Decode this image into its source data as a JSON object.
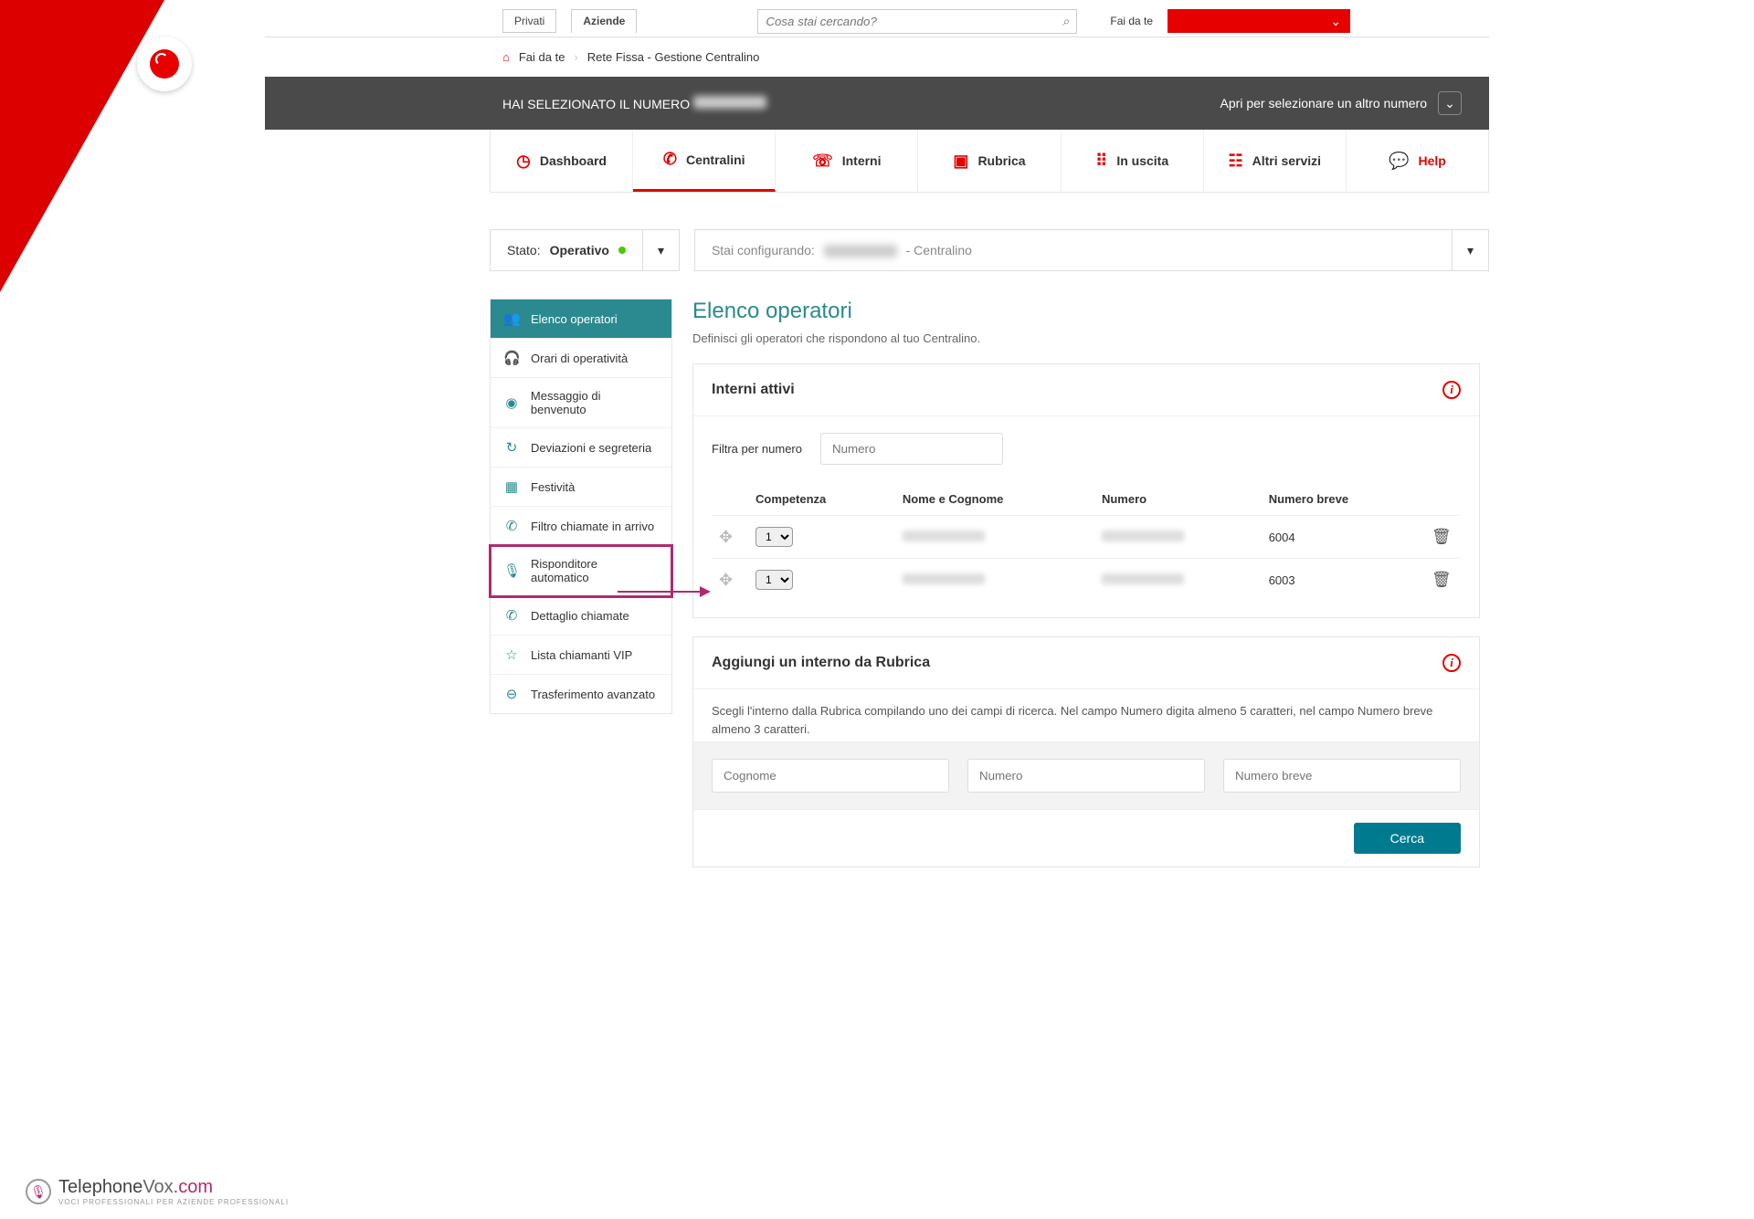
{
  "top": {
    "tab_private": "Privati",
    "tab_business": "Aziende",
    "search_placeholder": "Cosa stai cercando?",
    "fai_label": "Fai da te"
  },
  "breadcrumb": {
    "home": "Fai da te",
    "page": "Rete Fissa - Gestione Centralino"
  },
  "numberbar": {
    "left_prefix": "HAI SELEZIONATO IL NUMERO",
    "right": "Apri per selezionare un altro numero"
  },
  "tabs": {
    "dashboard": "Dashboard",
    "centralini": "Centralini",
    "interni": "Interni",
    "rubrica": "Rubrica",
    "uscita": "In uscita",
    "altri": "Altri servizi",
    "help": "Help"
  },
  "stato": {
    "label": "Stato:",
    "value": "Operativo"
  },
  "config": {
    "label": "Stai configurando:",
    "suffix": "- Centralino"
  },
  "sidemenu": {
    "elenco": "Elenco operatori",
    "orari": "Orari di operatività",
    "msg": "Messaggio di benvenuto",
    "dev": "Deviazioni e segreteria",
    "fest": "Festività",
    "filtro": "Filtro chiamate in arrivo",
    "risp": "Risponditore automatico",
    "dett": "Dettaglio chiamate",
    "vip": "Lista chiamanti VIP",
    "trasf": "Trasferimento avanzato"
  },
  "main": {
    "title": "Elenco operatori",
    "subtitle": "Definisci gli operatori che rispondono al tuo Centralino.",
    "panel1_title": "Interni attivi",
    "filter_label": "Filtra per numero",
    "filter_placeholder": "Numero",
    "cols": {
      "comp": "Competenza",
      "nome": "Nome e Cognome",
      "num": "Numero",
      "breve": "Numero breve"
    },
    "rows": [
      {
        "comp": "1",
        "breve": "6004"
      },
      {
        "comp": "1",
        "breve": "6003"
      }
    ],
    "panel2_title": "Aggiungi un interno da Rubrica",
    "panel2_desc": "Scegli l'interno dalla Rubrica compilando uno dei campi di ricerca. Nel campo Numero digita almeno 5 caratteri, nel campo Numero breve almeno 3 caratteri.",
    "ph_cognome": "Cognome",
    "ph_numero": "Numero",
    "ph_breve": "Numero breve",
    "btn_cerca": "Cerca"
  },
  "footer": {
    "brand1": "Telephone",
    "brand2": "Vox",
    "dom": ".com",
    "sub": "VOCI PROFESSIONALI PER AZIENDE PROFESSIONALI"
  }
}
